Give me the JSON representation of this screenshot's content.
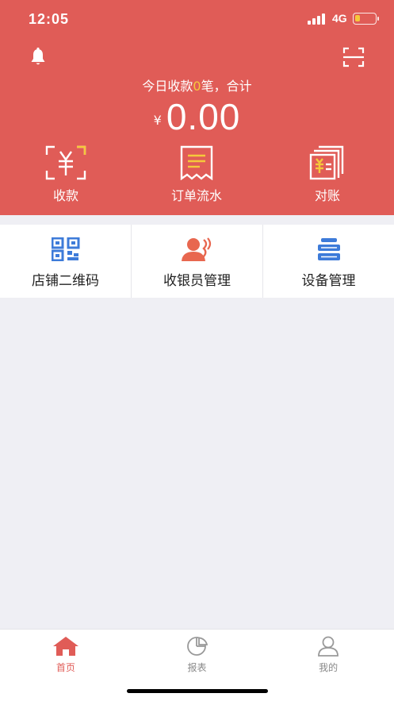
{
  "status_bar": {
    "time": "12:05",
    "network": "4G",
    "battery_level": 0.25
  },
  "header": {
    "summary_prefix": "今日收款",
    "order_count": "0",
    "summary_suffix": "笔，合计",
    "currency_symbol": "¥",
    "total_amount": "0.00",
    "bell_icon": "bell-icon",
    "scan_icon": "scan-icon"
  },
  "quick_actions": [
    {
      "label": "收款",
      "icon": "yuan-scan-icon"
    },
    {
      "label": "订单流水",
      "icon": "receipt-icon"
    },
    {
      "label": "对账",
      "icon": "reconcile-icon"
    }
  ],
  "menu": [
    {
      "label": "店铺二维码",
      "icon": "qr-code-icon"
    },
    {
      "label": "收银员管理",
      "icon": "cashier-icon"
    },
    {
      "label": "设备管理",
      "icon": "device-icon"
    }
  ],
  "tabs": [
    {
      "label": "首页",
      "icon": "home-icon",
      "active": true
    },
    {
      "label": "报表",
      "icon": "pie-chart-icon",
      "active": false
    },
    {
      "label": "我的",
      "icon": "user-icon",
      "active": false
    }
  ],
  "colors": {
    "primary": "#e05c57",
    "accent_yellow": "#f5c83b",
    "menu_blue": "#3d7bd9",
    "menu_coral": "#e8674f",
    "page_background": "#efeff4"
  }
}
